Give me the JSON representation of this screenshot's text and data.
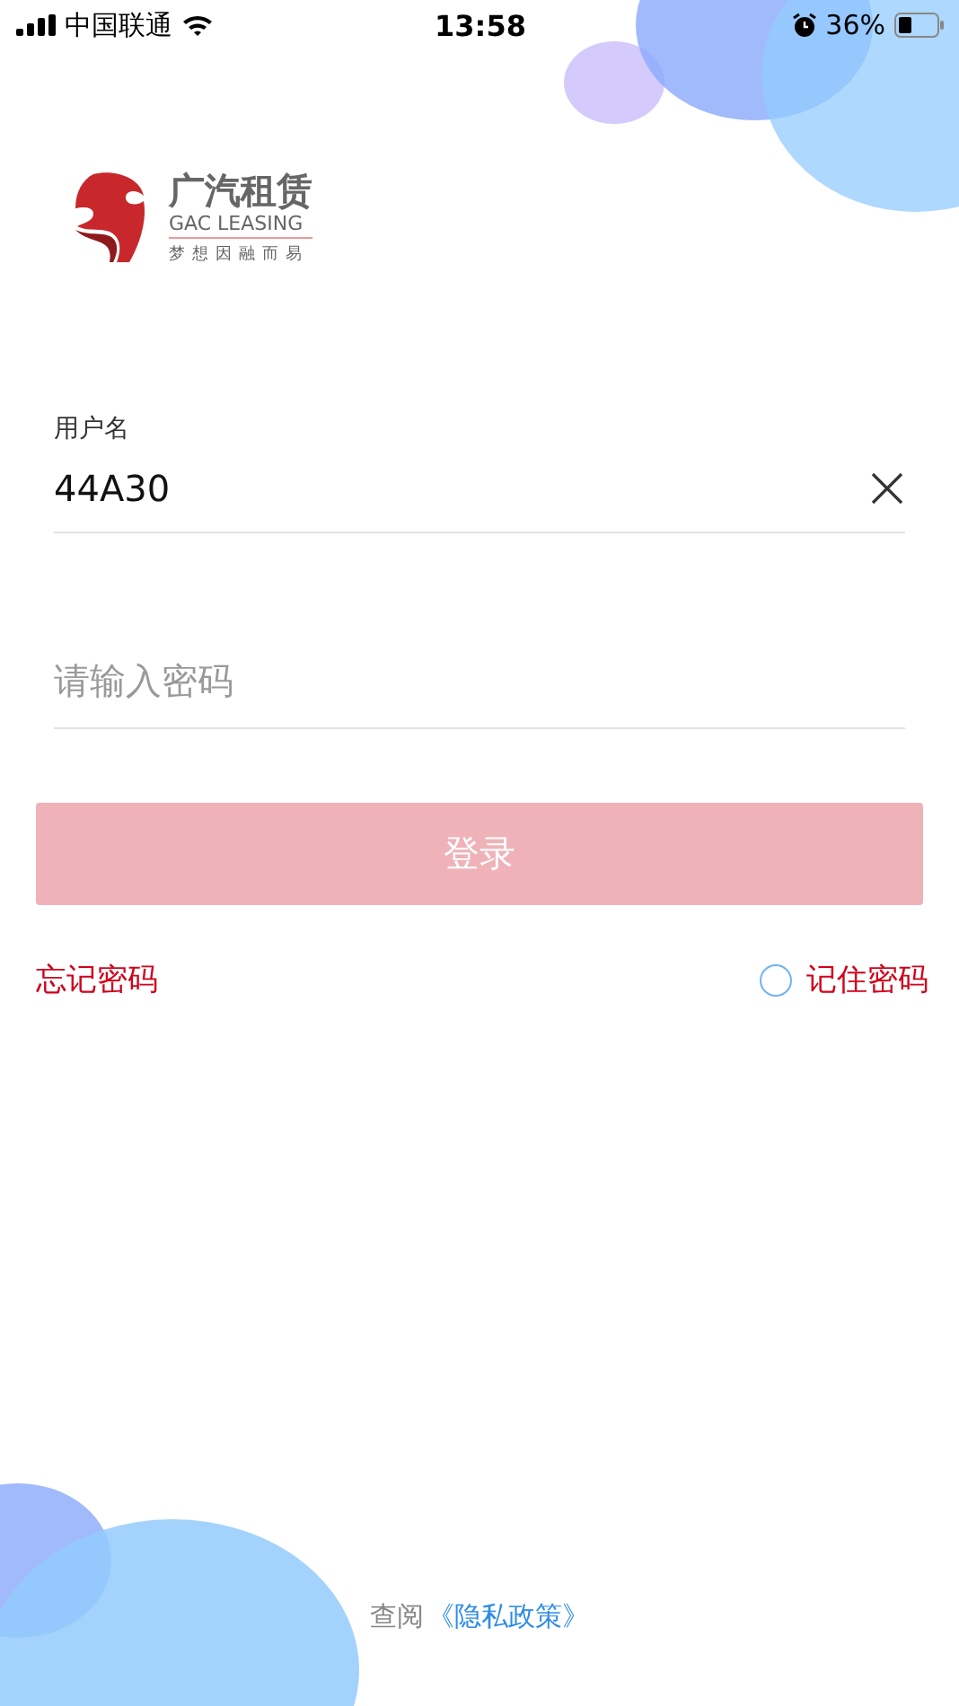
{
  "status_bar": {
    "carrier": "中国联通",
    "time": "13:58",
    "battery": "36%"
  },
  "logo": {
    "name": "广汽租赁",
    "english": "GAC LEASING",
    "slogan": "梦想因融而易"
  },
  "username": {
    "label": "用户名",
    "value": "44A30"
  },
  "password": {
    "placeholder": "请输入密码"
  },
  "login_button": {
    "label": "登录",
    "disabled": true
  },
  "forgot_link": "忘记密码",
  "remember": {
    "label": "记住密码",
    "checked": false
  },
  "footer": {
    "prefix": "查阅",
    "link": "《隐私政策》"
  }
}
